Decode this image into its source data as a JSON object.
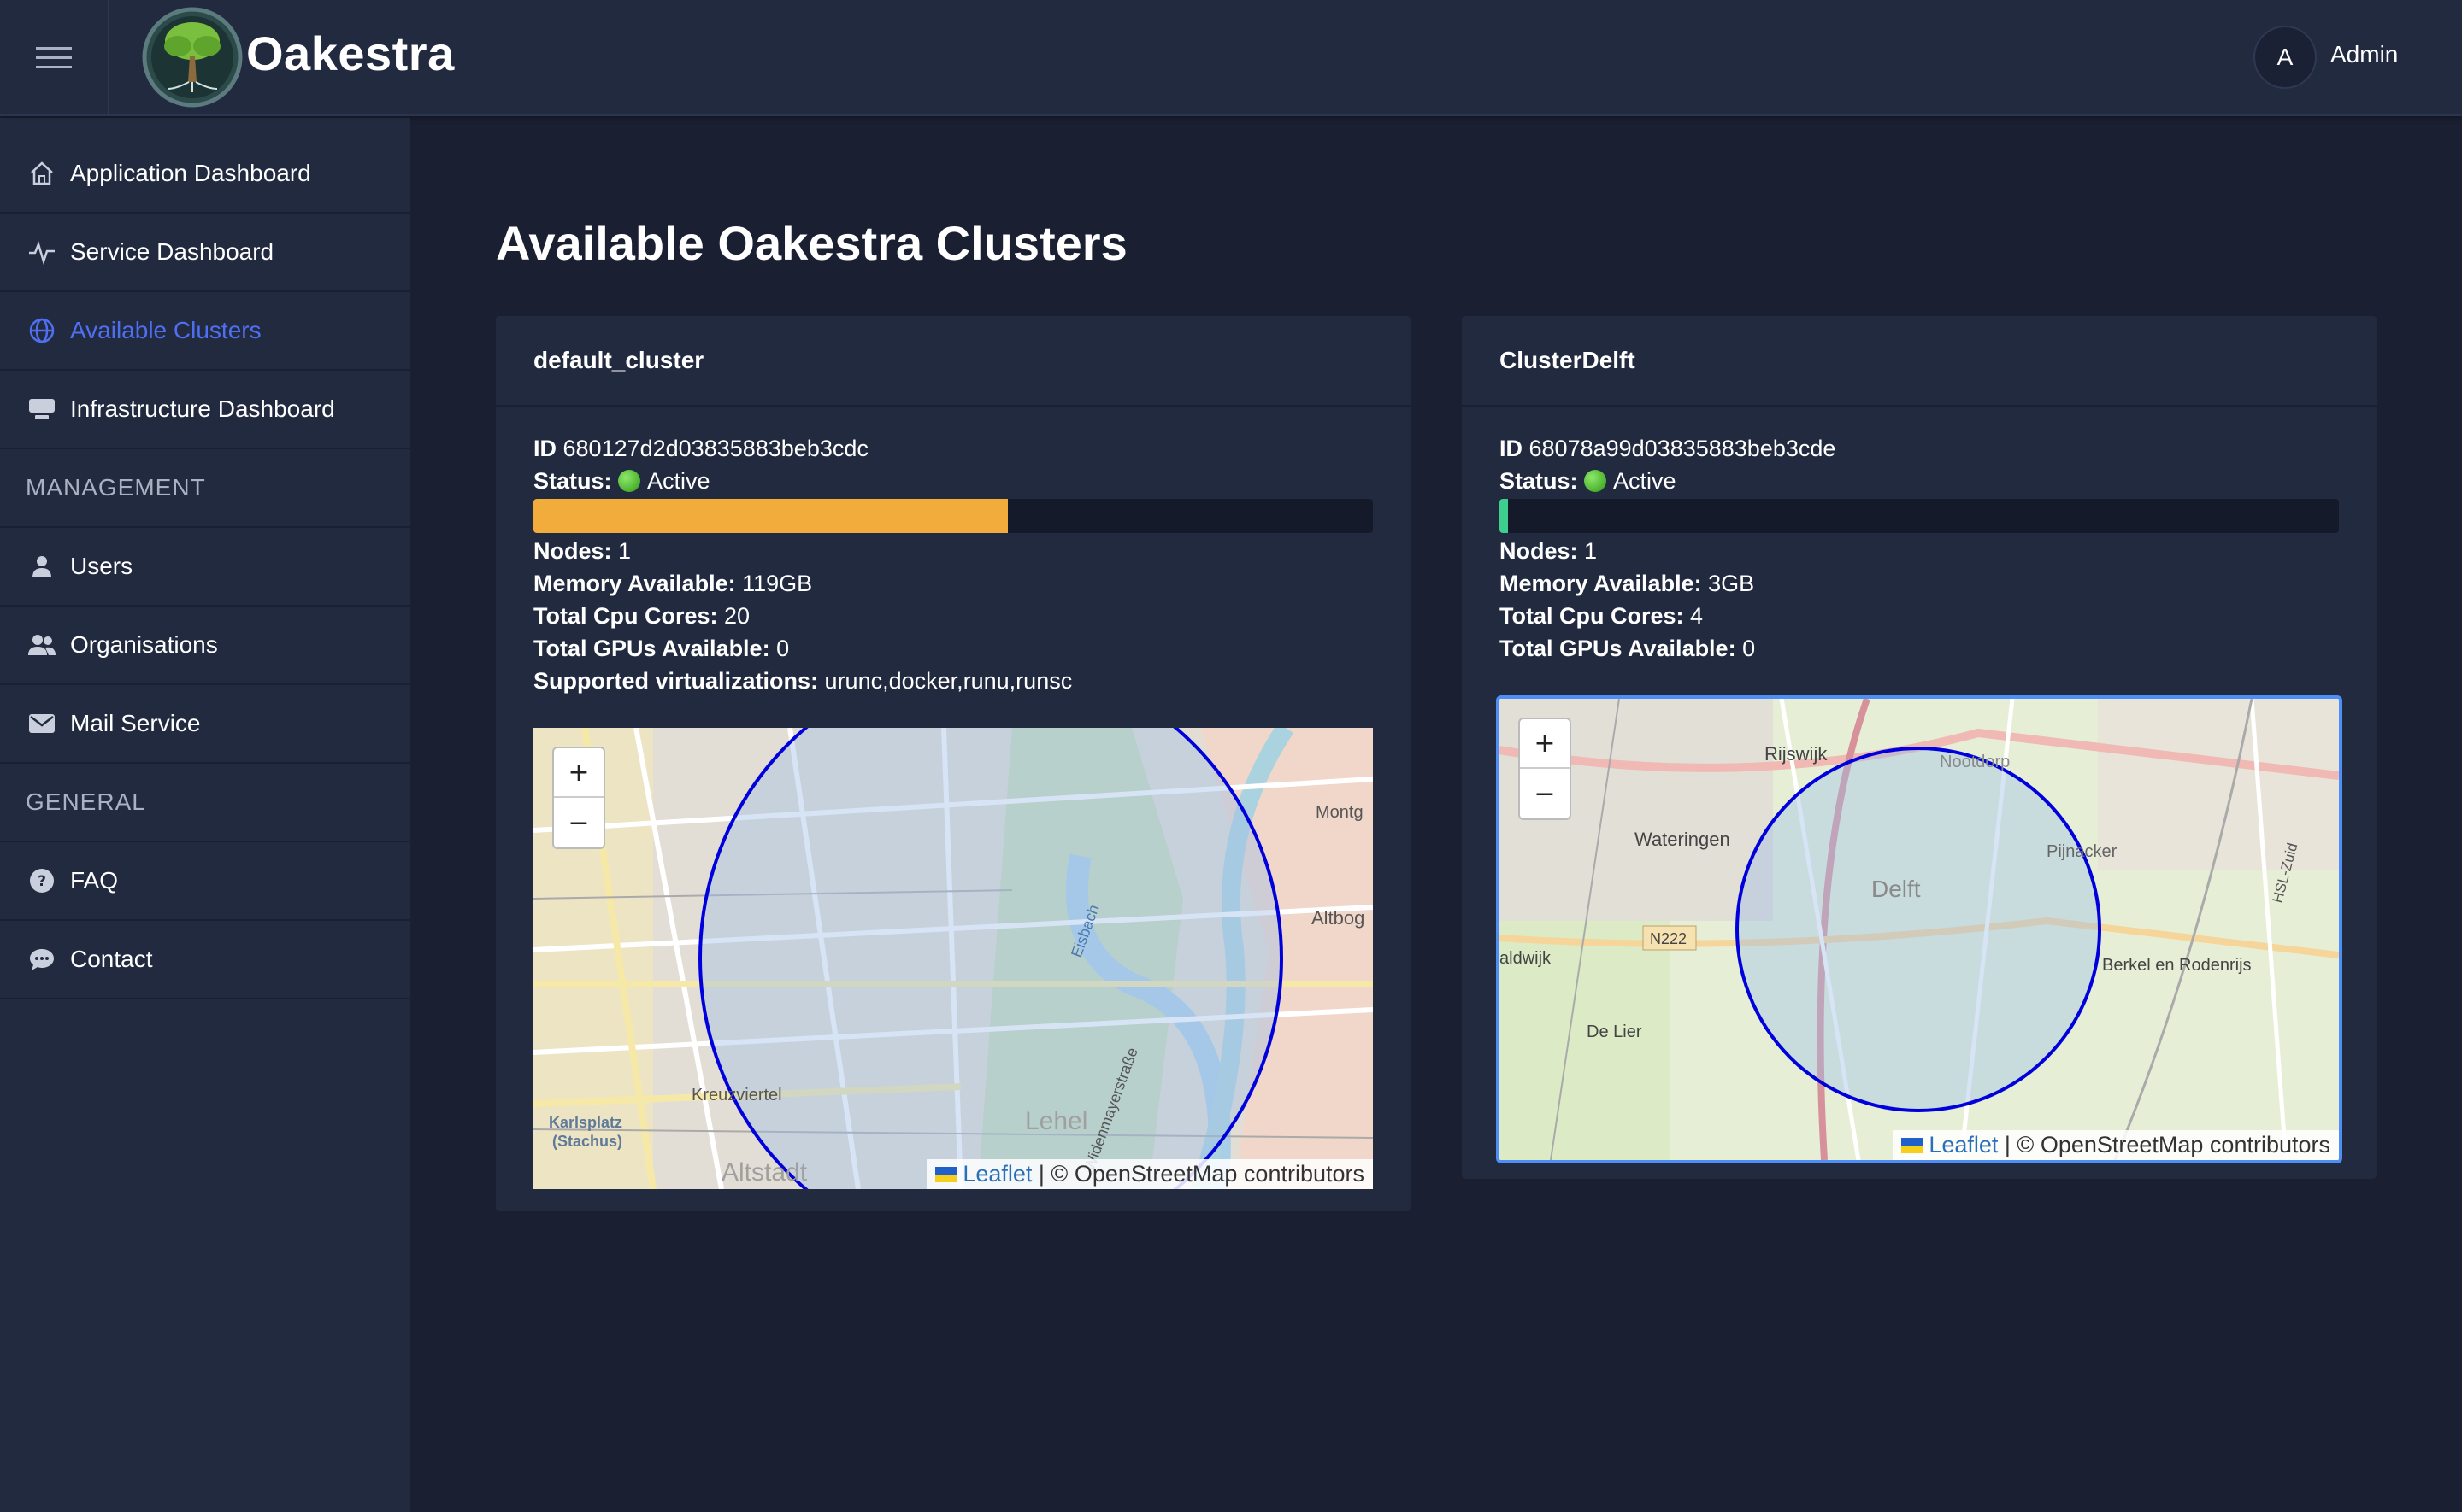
{
  "header": {
    "brand": "Oakestra",
    "user_initial": "A",
    "user_name": "Admin"
  },
  "sidebar": {
    "items": [
      {
        "label": "Application Dashboard",
        "icon": "home-icon",
        "active": false
      },
      {
        "label": "Service Dashboard",
        "icon": "activity-icon",
        "active": false
      },
      {
        "label": "Available Clusters",
        "icon": "globe-icon",
        "active": true
      },
      {
        "label": "Infrastructure Dashboard",
        "icon": "server-icon",
        "active": false
      }
    ],
    "management_label": "MANAGEMENT",
    "management_items": [
      {
        "label": "Users",
        "icon": "user-icon"
      },
      {
        "label": "Organisations",
        "icon": "users-icon"
      },
      {
        "label": "Mail Service",
        "icon": "mail-icon"
      }
    ],
    "general_label": "GENERAL",
    "general_items": [
      {
        "label": "FAQ",
        "icon": "question-icon"
      },
      {
        "label": "Contact",
        "icon": "chat-icon"
      }
    ]
  },
  "main": {
    "title": "Available Oakestra Clusters"
  },
  "labels": {
    "id": "ID",
    "status": "Status:",
    "nodes": "Nodes:",
    "memory": "Memory Available:",
    "cpu": "Total Cpu Cores:",
    "gpus": "Total GPUs Available:",
    "virt": "Supported virtualizations:"
  },
  "colors": {
    "accent": "#4f6ff0",
    "usage_bar_high": "#f2ac3b",
    "usage_bar_low": "#3ecf8e",
    "status_active": "#3fb21c",
    "map_circle": "#0000dd"
  },
  "clusters": [
    {
      "name": "default_cluster",
      "id": "680127d2d03835883beb3cdc",
      "status": "Active",
      "usage_fraction": 0.565,
      "nodes": "1",
      "memory": "119GB",
      "cpu": "20",
      "gpus": "0",
      "virtualizations": "urunc,docker,runu,runsc",
      "map": {
        "attribution_leaflet": "Leaflet",
        "attribution_rest": " | © OpenStreetMap contributors",
        "places": [
          "Montg",
          "Altbog",
          "Kreuzviertel",
          "Karlsplatz",
          "(Stachus)",
          "Altstadt",
          "Lehel",
          "Widenmayerstraße",
          "Eisbach"
        ]
      }
    },
    {
      "name": "ClusterDelft",
      "id": "68078a99d03835883beb3cde",
      "status": "Active",
      "usage_fraction": 0.01,
      "nodes": "1",
      "memory": "3GB",
      "cpu": "4",
      "gpus": "0",
      "map": {
        "attribution_leaflet": "Leaflet",
        "attribution_rest": " | © OpenStreetMap contributors",
        "places": [
          "Rijswijk",
          "Nootdorp",
          "Wateringen",
          "Delft",
          "Pijnacker",
          "N222",
          "aldwijk",
          "Berkel en Rodenrijs",
          "De Lier",
          "HSL-Zuid"
        ]
      }
    }
  ],
  "map_controls": {
    "zoom_in": "+",
    "zoom_out": "−"
  }
}
